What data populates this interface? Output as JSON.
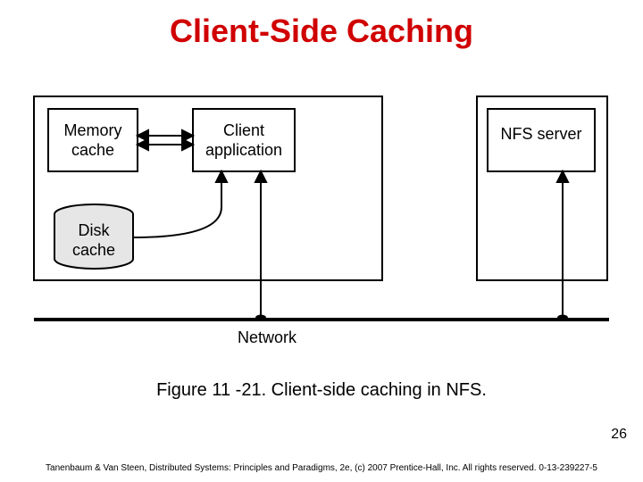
{
  "title": "Client-Side Caching",
  "diagram": {
    "boxes": {
      "memory_cache_l1": "Memory",
      "memory_cache_l2": "cache",
      "client_app_l1": "Client",
      "client_app_l2": "application",
      "disk_cache_l1": "Disk",
      "disk_cache_l2": "cache",
      "nfs_server": "NFS server"
    },
    "labels": {
      "network": "Network"
    }
  },
  "caption": "Figure 11 -21. Client-side caching in NFS.",
  "page_number": "26",
  "footer": "Tanenbaum & Van Steen, Distributed Systems: Principles and Paradigms, 2e, (c) 2007 Prentice-Hall, Inc. All rights reserved. 0-13-239227-5"
}
